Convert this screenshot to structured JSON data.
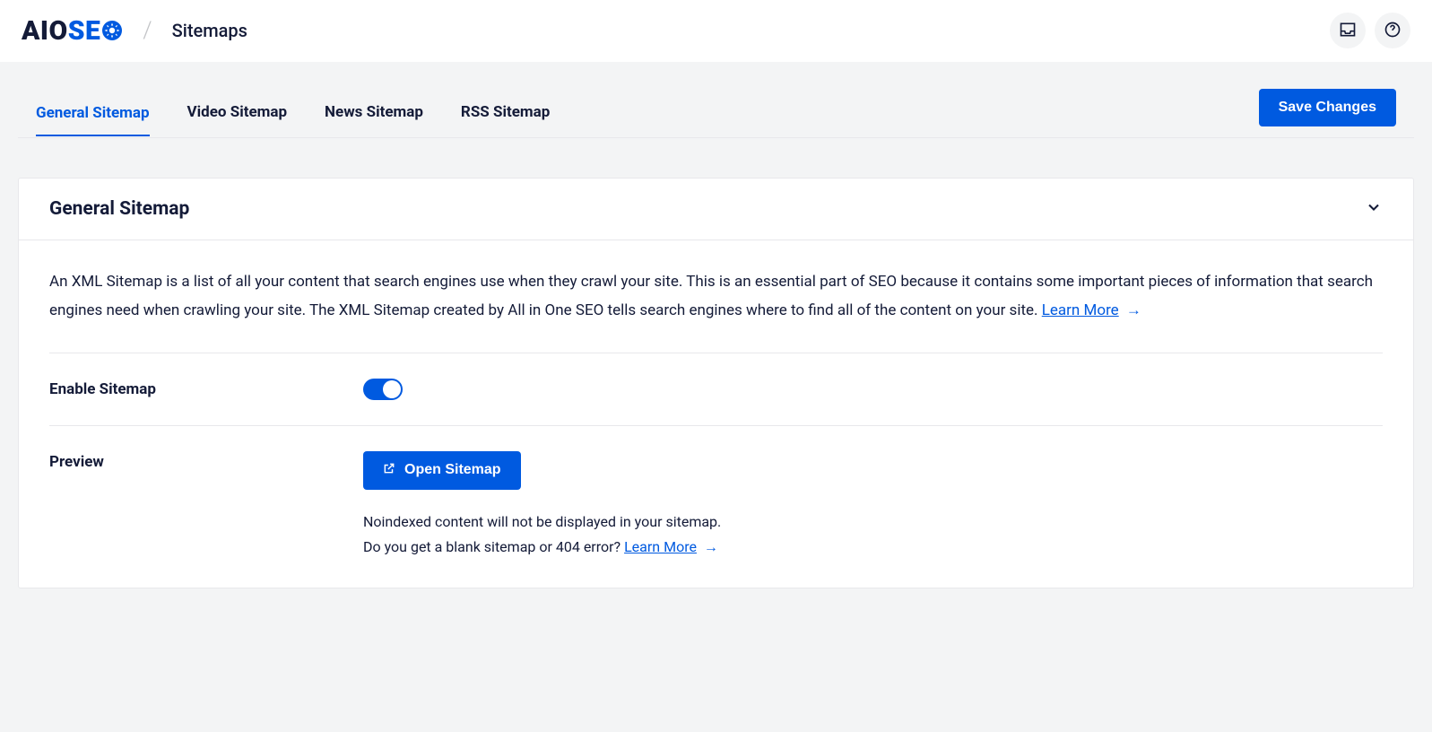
{
  "header": {
    "logoPrefix": "AIO",
    "logoSuffix": "SE",
    "pageTitle": "Sitemaps"
  },
  "tabs": [
    {
      "label": "General Sitemap",
      "active": true
    },
    {
      "label": "Video Sitemap",
      "active": false
    },
    {
      "label": "News Sitemap",
      "active": false
    },
    {
      "label": "RSS Sitemap",
      "active": false
    }
  ],
  "saveButton": "Save Changes",
  "panel": {
    "title": "General Sitemap",
    "description": "An XML Sitemap is a list of all your content that search engines use when they crawl your site. This is an essential part of SEO because it contains some important pieces of information that search engines need when crawling your site. The XML Sitemap created by All in One SEO tells search engines where to find all of the content on your site. ",
    "learnMore": "Learn More",
    "enable": {
      "label": "Enable Sitemap",
      "value": true
    },
    "preview": {
      "label": "Preview",
      "button": "Open Sitemap",
      "note1": "Noindexed content will not be displayed in your sitemap.",
      "note2a": "Do you get a blank sitemap or 404 error? ",
      "note2link": "Learn More"
    }
  }
}
